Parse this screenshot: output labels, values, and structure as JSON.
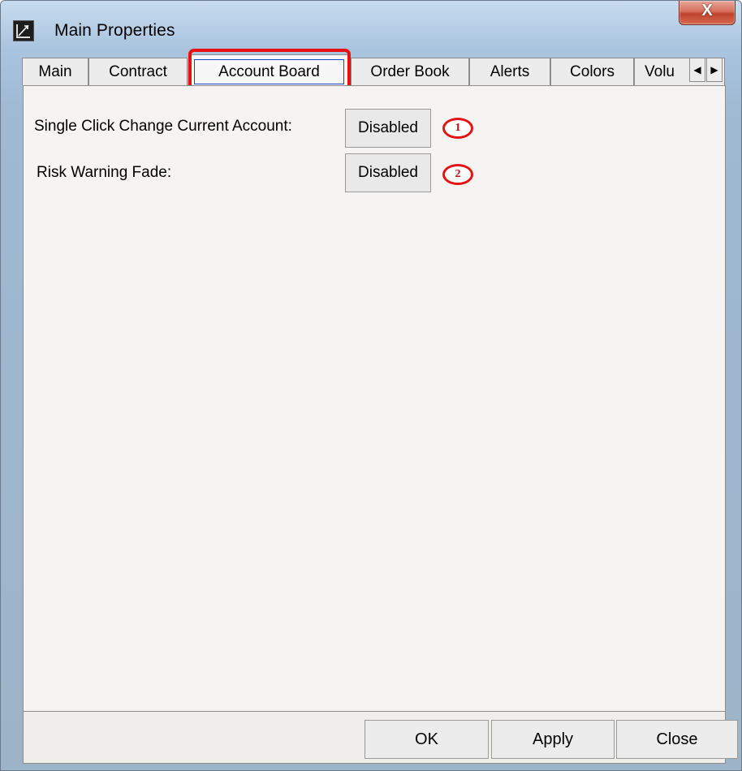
{
  "window": {
    "title": "Main Properties",
    "close_label": "X"
  },
  "tabs": [
    {
      "label": "Main"
    },
    {
      "label": "Contract"
    },
    {
      "label": "Account Board",
      "active": true
    },
    {
      "label": "Order Book"
    },
    {
      "label": "Alerts"
    },
    {
      "label": "Colors"
    },
    {
      "label": "Volu"
    }
  ],
  "tab_scroll": {
    "left": "◀",
    "right": "▶"
  },
  "settings": [
    {
      "label": "Single Click Change Current Account:",
      "value": "Disabled",
      "marker": "1"
    },
    {
      "label": "Risk Warning Fade:",
      "value": "Disabled",
      "marker": "2"
    }
  ],
  "footer": {
    "ok": "OK",
    "apply": "Apply",
    "close": "Close"
  },
  "colors": {
    "highlight": "#e81010",
    "active_focus": "#1c44c9"
  }
}
